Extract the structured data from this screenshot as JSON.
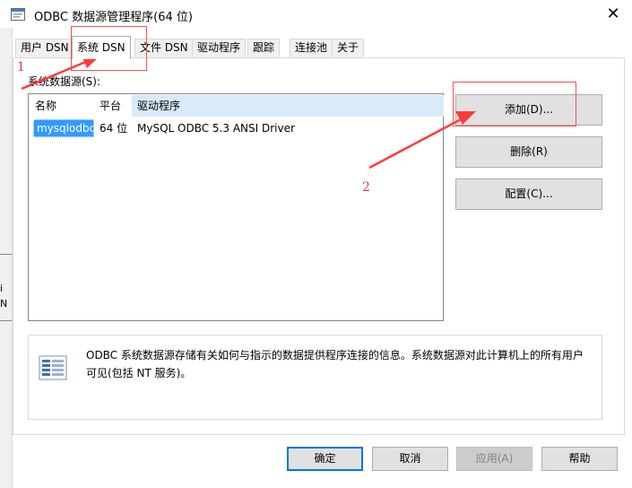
{
  "window": {
    "title": "ODBC 数据源管理程序(64 位)",
    "close_symbol": "✕"
  },
  "left_strip_chars": [
    "i",
    "N"
  ],
  "tabs": [
    {
      "label": "用户 DSN",
      "active": false
    },
    {
      "label": "系统 DSN",
      "active": true
    },
    {
      "label": "文件 DSN",
      "active": false
    },
    {
      "label": "驱动程序",
      "active": false
    },
    {
      "label": "跟踪",
      "active": false
    },
    {
      "label": "连接池",
      "active": false
    },
    {
      "label": "关于",
      "active": false
    }
  ],
  "sources_label": "系统数据源(S):",
  "list": {
    "columns": [
      "名称",
      "平台",
      "驱动程序"
    ],
    "rows": [
      {
        "name": "mysqlodbc",
        "platform": "64 位",
        "driver": "MySQL ODBC 5.3 ANSI Driver"
      }
    ]
  },
  "side_buttons": {
    "add": "添加(D)...",
    "remove": "删除(R)",
    "configure": "配置(C)..."
  },
  "info_text": "ODBC 系统数据源存储有关如何与指示的数据提供程序连接的信息。系统数据源对此计算机上的所有用户可见(包括 NT 服务)。",
  "bottom_buttons": {
    "ok": "确定",
    "cancel": "取消",
    "apply": "应用(A)",
    "help": "帮助"
  },
  "annotations": {
    "step1": "1",
    "step2": "2",
    "color": "#ff3b3b"
  },
  "icons": {
    "title": "odbc-window-icon",
    "info": "database-info-icon"
  }
}
